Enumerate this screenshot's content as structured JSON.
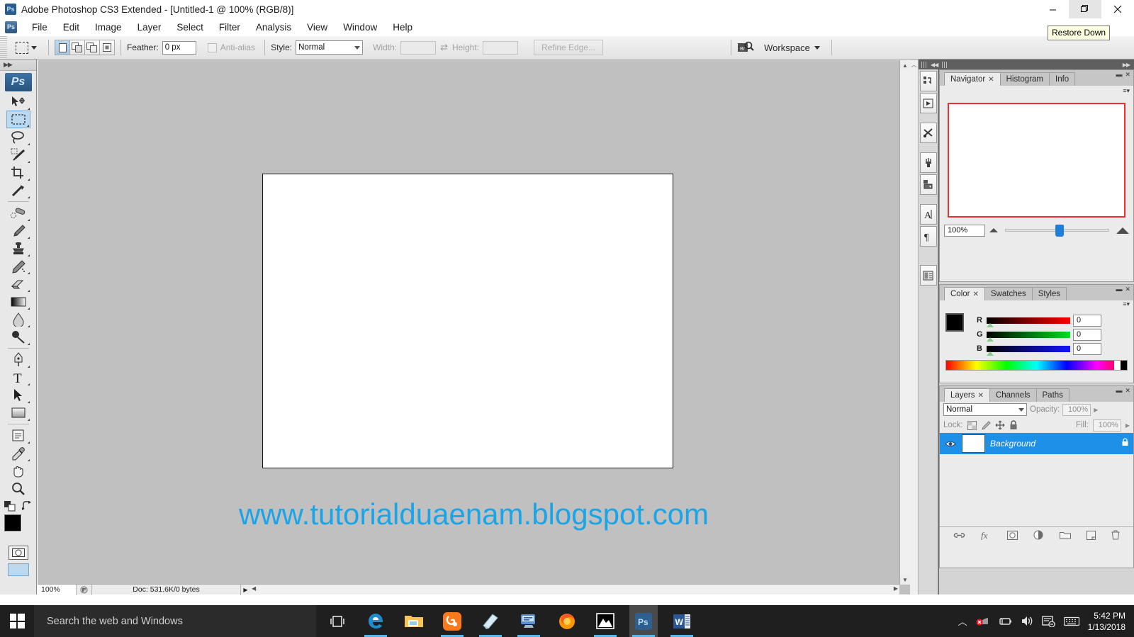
{
  "window": {
    "title": "Adobe Photoshop CS3 Extended - [Untitled-1 @ 100% (RGB/8)]",
    "app_icon": "Ps",
    "minimize": "minimize-icon",
    "restore": "restore-icon",
    "close": "close-icon",
    "tooltip": "Restore Down"
  },
  "menu": {
    "items": [
      {
        "label": "File"
      },
      {
        "label": "Edit"
      },
      {
        "label": "Image"
      },
      {
        "label": "Layer"
      },
      {
        "label": "Select"
      },
      {
        "label": "Filter"
      },
      {
        "label": "Analysis"
      },
      {
        "label": "View"
      },
      {
        "label": "Window"
      },
      {
        "label": "Help"
      }
    ]
  },
  "options_bar": {
    "feather_label": "Feather:",
    "feather_value": "0 px",
    "antialias_label": "Anti-alias",
    "style_label": "Style:",
    "style_value": "Normal",
    "width_label": "Width:",
    "width_value": "",
    "height_label": "Height:",
    "height_value": "",
    "refine_edge": "Refine Edge...",
    "workspace": "Workspace",
    "bridge_icon": "bridge-icon"
  },
  "toolbox": {
    "logo": "Ps",
    "tools": [
      {
        "name": "move-tool"
      },
      {
        "name": "rectangular-marquee-tool",
        "selected": true
      },
      {
        "name": "lasso-tool"
      },
      {
        "name": "magic-wand-tool"
      },
      {
        "name": "crop-tool"
      },
      {
        "name": "slice-tool"
      },
      {
        "name": "healing-brush-tool"
      },
      {
        "name": "brush-tool"
      },
      {
        "name": "clone-stamp-tool"
      },
      {
        "name": "history-brush-tool"
      },
      {
        "name": "eraser-tool"
      },
      {
        "name": "gradient-tool"
      },
      {
        "name": "blur-tool"
      },
      {
        "name": "dodge-tool"
      },
      {
        "name": "pen-tool"
      },
      {
        "name": "horizontal-type-tool"
      },
      {
        "name": "path-selection-tool"
      },
      {
        "name": "rectangle-shape-tool"
      },
      {
        "name": "notes-tool"
      },
      {
        "name": "eyedropper-tool"
      },
      {
        "name": "hand-tool"
      },
      {
        "name": "zoom-tool"
      }
    ],
    "foreground_color": "#000000",
    "background_color": "#ffffff"
  },
  "document": {
    "watermark": "www.tutorialduaenam.blogspot.com",
    "canvas_color": "#ffffff",
    "workspace_color": "#c0c0c0"
  },
  "status_bar": {
    "zoom": "100%",
    "doc_info": "Doc: 531.6K/0 bytes"
  },
  "panels": {
    "navigator": {
      "tabs": [
        "Navigator",
        "Histogram",
        "Info"
      ],
      "active_tab": "Navigator",
      "zoom_value": "100%",
      "thumb_border_color": "#ef2f2f"
    },
    "color": {
      "tabs": [
        "Color",
        "Swatches",
        "Styles"
      ],
      "active_tab": "Color",
      "channels": [
        {
          "label": "R",
          "value": "0"
        },
        {
          "label": "G",
          "value": "0"
        },
        {
          "label": "B",
          "value": "0"
        }
      ]
    },
    "layers": {
      "tabs": [
        "Layers",
        "Channels",
        "Paths"
      ],
      "active_tab": "Layers",
      "blend_mode": "Normal",
      "opacity_label": "Opacity:",
      "opacity_value": "100%",
      "lock_label": "Lock:",
      "fill_label": "Fill:",
      "fill_value": "100%",
      "rows": [
        {
          "name": "Background",
          "locked": true,
          "visible": true
        }
      ],
      "footer_icons": [
        "link-layers-icon",
        "layer-style-icon",
        "layer-mask-icon",
        "adjustment-layer-icon",
        "new-group-icon",
        "new-layer-icon",
        "delete-layer-icon"
      ]
    },
    "selected_layer_color": "#1e90e8"
  },
  "taskbar": {
    "start": "windows-start-icon",
    "search_placeholder": "Search the web and Windows",
    "task_view": "task-view-icon",
    "apps": [
      {
        "name": "microsoft-edge-icon"
      },
      {
        "name": "file-explorer-icon"
      },
      {
        "name": "uc-browser-icon"
      },
      {
        "name": "notes-app-icon"
      },
      {
        "name": "remote-desktop-icon"
      },
      {
        "name": "mozilla-firefox-icon"
      },
      {
        "name": "photo-viewer-icon"
      },
      {
        "name": "adobe-photoshop-icon"
      },
      {
        "name": "microsoft-word-icon"
      }
    ],
    "tray": [
      "show-hidden-icons",
      "network-error-icon",
      "battery-icon",
      "volume-icon",
      "action-center-icon",
      "keyboard-icon"
    ],
    "time": "5:42 PM",
    "date": "1/13/2018"
  }
}
